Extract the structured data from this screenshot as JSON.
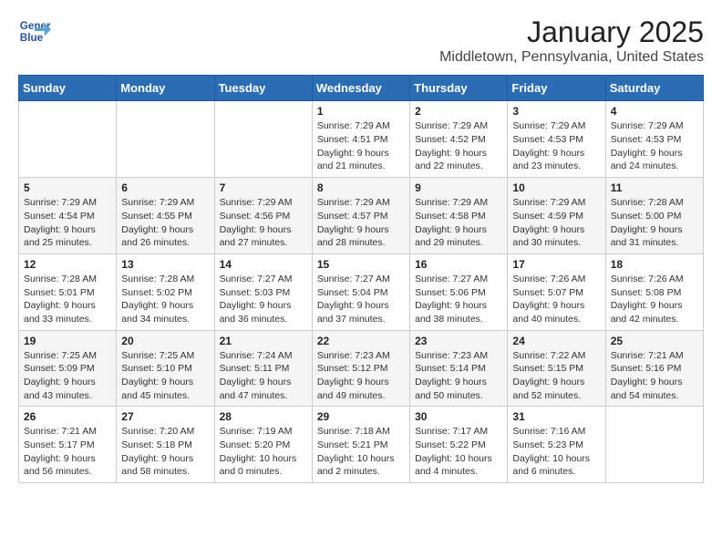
{
  "logo": {
    "line1": "General",
    "line2": "Blue"
  },
  "title": "January 2025",
  "subtitle": "Middletown, Pennsylvania, United States",
  "weekdays": [
    "Sunday",
    "Monday",
    "Tuesday",
    "Wednesday",
    "Thursday",
    "Friday",
    "Saturday"
  ],
  "weeks": [
    [
      {
        "day": "",
        "info": ""
      },
      {
        "day": "",
        "info": ""
      },
      {
        "day": "",
        "info": ""
      },
      {
        "day": "1",
        "info": "Sunrise: 7:29 AM\nSunset: 4:51 PM\nDaylight: 9 hours and 21 minutes."
      },
      {
        "day": "2",
        "info": "Sunrise: 7:29 AM\nSunset: 4:52 PM\nDaylight: 9 hours and 22 minutes."
      },
      {
        "day": "3",
        "info": "Sunrise: 7:29 AM\nSunset: 4:53 PM\nDaylight: 9 hours and 23 minutes."
      },
      {
        "day": "4",
        "info": "Sunrise: 7:29 AM\nSunset: 4:53 PM\nDaylight: 9 hours and 24 minutes."
      }
    ],
    [
      {
        "day": "5",
        "info": "Sunrise: 7:29 AM\nSunset: 4:54 PM\nDaylight: 9 hours and 25 minutes."
      },
      {
        "day": "6",
        "info": "Sunrise: 7:29 AM\nSunset: 4:55 PM\nDaylight: 9 hours and 26 minutes."
      },
      {
        "day": "7",
        "info": "Sunrise: 7:29 AM\nSunset: 4:56 PM\nDaylight: 9 hours and 27 minutes."
      },
      {
        "day": "8",
        "info": "Sunrise: 7:29 AM\nSunset: 4:57 PM\nDaylight: 9 hours and 28 minutes."
      },
      {
        "day": "9",
        "info": "Sunrise: 7:29 AM\nSunset: 4:58 PM\nDaylight: 9 hours and 29 minutes."
      },
      {
        "day": "10",
        "info": "Sunrise: 7:29 AM\nSunset: 4:59 PM\nDaylight: 9 hours and 30 minutes."
      },
      {
        "day": "11",
        "info": "Sunrise: 7:28 AM\nSunset: 5:00 PM\nDaylight: 9 hours and 31 minutes."
      }
    ],
    [
      {
        "day": "12",
        "info": "Sunrise: 7:28 AM\nSunset: 5:01 PM\nDaylight: 9 hours and 33 minutes."
      },
      {
        "day": "13",
        "info": "Sunrise: 7:28 AM\nSunset: 5:02 PM\nDaylight: 9 hours and 34 minutes."
      },
      {
        "day": "14",
        "info": "Sunrise: 7:27 AM\nSunset: 5:03 PM\nDaylight: 9 hours and 36 minutes."
      },
      {
        "day": "15",
        "info": "Sunrise: 7:27 AM\nSunset: 5:04 PM\nDaylight: 9 hours and 37 minutes."
      },
      {
        "day": "16",
        "info": "Sunrise: 7:27 AM\nSunset: 5:06 PM\nDaylight: 9 hours and 38 minutes."
      },
      {
        "day": "17",
        "info": "Sunrise: 7:26 AM\nSunset: 5:07 PM\nDaylight: 9 hours and 40 minutes."
      },
      {
        "day": "18",
        "info": "Sunrise: 7:26 AM\nSunset: 5:08 PM\nDaylight: 9 hours and 42 minutes."
      }
    ],
    [
      {
        "day": "19",
        "info": "Sunrise: 7:25 AM\nSunset: 5:09 PM\nDaylight: 9 hours and 43 minutes."
      },
      {
        "day": "20",
        "info": "Sunrise: 7:25 AM\nSunset: 5:10 PM\nDaylight: 9 hours and 45 minutes."
      },
      {
        "day": "21",
        "info": "Sunrise: 7:24 AM\nSunset: 5:11 PM\nDaylight: 9 hours and 47 minutes."
      },
      {
        "day": "22",
        "info": "Sunrise: 7:23 AM\nSunset: 5:12 PM\nDaylight: 9 hours and 49 minutes."
      },
      {
        "day": "23",
        "info": "Sunrise: 7:23 AM\nSunset: 5:14 PM\nDaylight: 9 hours and 50 minutes."
      },
      {
        "day": "24",
        "info": "Sunrise: 7:22 AM\nSunset: 5:15 PM\nDaylight: 9 hours and 52 minutes."
      },
      {
        "day": "25",
        "info": "Sunrise: 7:21 AM\nSunset: 5:16 PM\nDaylight: 9 hours and 54 minutes."
      }
    ],
    [
      {
        "day": "26",
        "info": "Sunrise: 7:21 AM\nSunset: 5:17 PM\nDaylight: 9 hours and 56 minutes."
      },
      {
        "day": "27",
        "info": "Sunrise: 7:20 AM\nSunset: 5:18 PM\nDaylight: 9 hours and 58 minutes."
      },
      {
        "day": "28",
        "info": "Sunrise: 7:19 AM\nSunset: 5:20 PM\nDaylight: 10 hours and 0 minutes."
      },
      {
        "day": "29",
        "info": "Sunrise: 7:18 AM\nSunset: 5:21 PM\nDaylight: 10 hours and 2 minutes."
      },
      {
        "day": "30",
        "info": "Sunrise: 7:17 AM\nSunset: 5:22 PM\nDaylight: 10 hours and 4 minutes."
      },
      {
        "day": "31",
        "info": "Sunrise: 7:16 AM\nSunset: 5:23 PM\nDaylight: 10 hours and 6 minutes."
      },
      {
        "day": "",
        "info": ""
      }
    ]
  ]
}
